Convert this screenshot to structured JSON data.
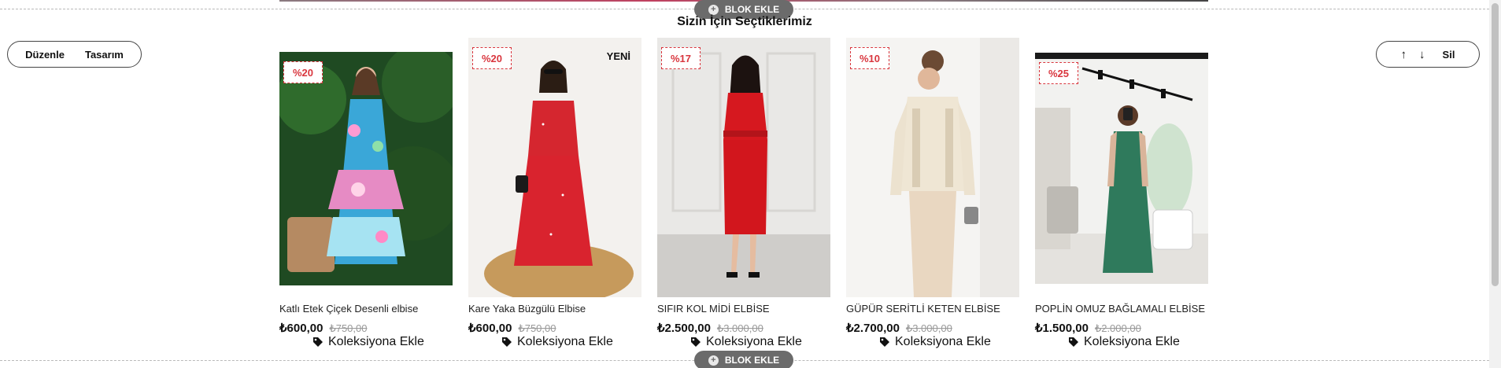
{
  "toolbar_top": {
    "label": "BLOK EKLE",
    "icon": "plus-circle-icon"
  },
  "toolbar_bottom": {
    "label": "BLOK EKLE",
    "icon": "plus-circle-icon"
  },
  "section": {
    "title": "Sizin İçin Seçtiklerimiz"
  },
  "left_controls": {
    "edit": "Düzenle",
    "design": "Tasarım"
  },
  "right_controls": {
    "up": "↑",
    "down": "↓",
    "delete": "Sil"
  },
  "collection_label": "Koleksiyona Ekle",
  "products": [
    {
      "badge": "%20",
      "new_label": "",
      "name": "Katlı Etek Çiçek Desenli elbise",
      "price": "₺600,00",
      "old_price": "₺750,00"
    },
    {
      "badge": "%20",
      "new_label": "YENİ",
      "name": "Kare Yaka Büzgülü Elbise",
      "price": "₺600,00",
      "old_price": "₺750,00"
    },
    {
      "badge": "%17",
      "new_label": "",
      "name": "SIFIR KOL MİDİ ELBİSE",
      "price": "₺2.500,00",
      "old_price": "₺3.000,00"
    },
    {
      "badge": "%10",
      "new_label": "",
      "name": "GÜPÜR SERİTLİ KETEN ELBİSE",
      "price": "₺2.700,00",
      "old_price": "₺3.000,00"
    },
    {
      "badge": "%25",
      "new_label": "",
      "name": "POPLİN OMUZ BAĞLAMALI ELBİSE",
      "price": "₺1.500,00",
      "old_price": "₺2.000,00"
    }
  ],
  "colors": {
    "discount": "#d9363e",
    "pill_bg": "#6b6b6b"
  }
}
